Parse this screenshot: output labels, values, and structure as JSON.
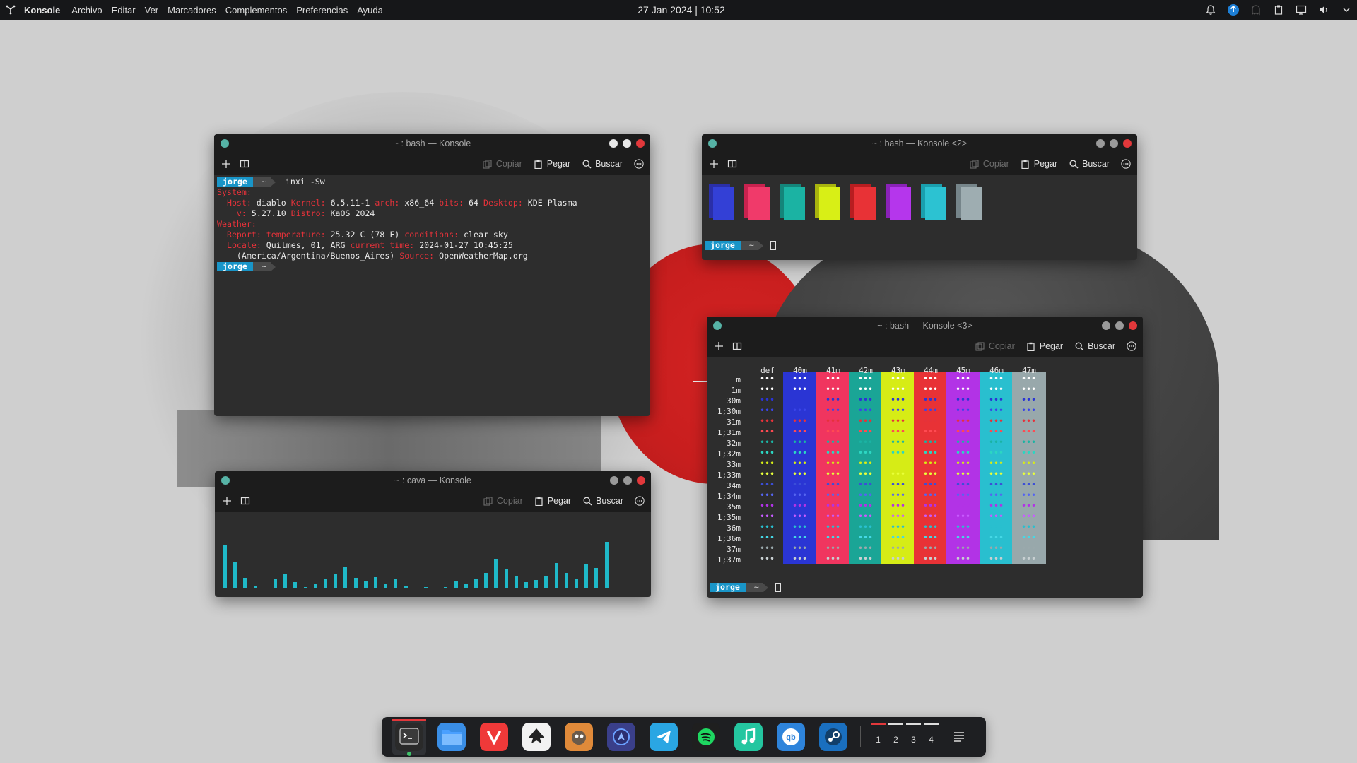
{
  "top_panel": {
    "app_name": "Konsole",
    "menus": [
      "Archivo",
      "Editar",
      "Ver",
      "Marcadores",
      "Complementos",
      "Preferencias",
      "Ayuda"
    ],
    "clock": "27 Jan 2024 | 10:52",
    "tray_icons": [
      "notifications-icon",
      "updates-icon",
      "ghost-icon",
      "clipboard-icon",
      "display-icon",
      "volume-icon",
      "chevron-down-icon"
    ]
  },
  "toolbar": {
    "copy_label": "Copiar",
    "paste_label": "Pegar",
    "search_label": "Buscar"
  },
  "win1": {
    "title": "~ : bash — Konsole",
    "prompt_user": "jorge",
    "prompt_dir": "~",
    "command": "inxi -Sw",
    "lines": {
      "system": "System:",
      "host_label": "  Host:",
      "host": " diablo ",
      "kernel_label": "Kernel:",
      "kernel": " 6.5.11-1 ",
      "arch_label": "arch:",
      "arch": " x86_64 ",
      "bits_label": "bits:",
      "bits": " 64 ",
      "desktop_label": "Desktop:",
      "desktop": " KDE Plasma",
      "v_label": "    v:",
      "v": " 5.27.10 ",
      "distro_label": "Distro:",
      "distro": " KaOS 2024",
      "weather": "Weather:",
      "report_label": "  Report:",
      "temp_label": " temperature:",
      "temp": " 25.32 C (78 F) ",
      "cond_label": "conditions:",
      "cond": " clear sky",
      "locale_label": "  Locale:",
      "locale": " Quilmes, 01, ARG ",
      "time_label": "current time:",
      "time": " 2024-01-27 10:45:25",
      "tz": "    (America/Argentina/Buenos_Aires) ",
      "source_label": "Source:",
      "source": " OpenWeatherMap.org"
    }
  },
  "win2": {
    "title": "~ : bash — Konsole <2>",
    "prompt_user": "jorge",
    "prompt_dir": "~",
    "swatches": [
      {
        "back": "#2a2fa8",
        "front": "#3340d6"
      },
      {
        "back": "#c9224f",
        "front": "#f03a6a"
      },
      {
        "back": "#14857a",
        "front": "#1bb3a3"
      },
      {
        "back": "#a8b40e",
        "front": "#d8ef16"
      },
      {
        "back": "#b81d20",
        "front": "#e83236"
      },
      {
        "back": "#8a22b8",
        "front": "#b536ec"
      },
      {
        "back": "#1a9fae",
        "front": "#2cc2d2"
      },
      {
        "back": "#76858a",
        "front": "#9eadb1"
      }
    ]
  },
  "win3": {
    "title": "~ : bash — Konsole <3>",
    "prompt_user": "jorge",
    "prompt_dir": "~",
    "headers": [
      "def",
      "40m",
      "41m",
      "42m",
      "43m",
      "44m",
      "45m",
      "46m",
      "47m"
    ],
    "row_labels": [
      "m",
      "1m",
      "30m",
      "1;30m",
      "31m",
      "1;31m",
      "32m",
      "1;32m",
      "33m",
      "1;33m",
      "34m",
      "1;34m",
      "35m",
      "1;35m",
      "36m",
      "1;36m",
      "37m",
      "1;37m"
    ],
    "column_colors": [
      "",
      "#2a35d4",
      "#f0355f",
      "#1aa596",
      "#d6ec16",
      "#e83236",
      "#b233e6",
      "#29bfcf",
      "#98a8ab"
    ],
    "dot_colors": [
      "#ffffff",
      "#ffffff",
      "#2a35d4",
      "#3a45e8",
      "#e5323a",
      "#ff4a52",
      "#1bb3a3",
      "#2cd6c2",
      "#d6ec16",
      "#e8ff3a",
      "#3b4ed8",
      "#5565f0",
      "#b233e6",
      "#c85cff",
      "#29bfcf",
      "#45d8e6",
      "#9aa9ac",
      "#c8d0d2"
    ],
    "dot_glyph": "•••"
  },
  "win4": {
    "title": "~ : cava — Konsole",
    "bar_color": "#1fb9c8",
    "bars": [
      0.61,
      0.37,
      0.15,
      0.03,
      0.01,
      0.14,
      0.2,
      0.09,
      0.02,
      0.06,
      0.13,
      0.21,
      0.3,
      0.15,
      0.11,
      0.16,
      0.06,
      0.13,
      0.03,
      0.01,
      0.02,
      0.01,
      0.02,
      0.11,
      0.06,
      0.14,
      0.22,
      0.42,
      0.27,
      0.17,
      0.09,
      0.12,
      0.18,
      0.36,
      0.22,
      0.13,
      0.35,
      0.29,
      0.66
    ]
  },
  "dock": {
    "apps": [
      {
        "name": "konsole",
        "color": "#2a2a2a",
        "active": true
      },
      {
        "name": "files",
        "color": "#3a8ee6",
        "active": false
      },
      {
        "name": "vivaldi",
        "color": "#ef3939",
        "active": false
      },
      {
        "name": "inkscape",
        "color": "#f2f2f2",
        "active": false
      },
      {
        "name": "gimp",
        "color": "#e08a3a",
        "active": false
      },
      {
        "name": "elisa",
        "color": "#3a3f8a",
        "active": false
      },
      {
        "name": "telegram",
        "color": "#2aa6e3",
        "active": false
      },
      {
        "name": "spotify",
        "color": "#1f1f1f",
        "active": false
      },
      {
        "name": "music",
        "color": "#24c6a0",
        "active": false
      },
      {
        "name": "qbittorrent",
        "color": "#2e84db",
        "active": false
      },
      {
        "name": "steam",
        "color": "#1a6fbf",
        "active": false
      }
    ],
    "desktops": [
      "1",
      "2",
      "3",
      "4"
    ],
    "active_desktop": 0
  }
}
